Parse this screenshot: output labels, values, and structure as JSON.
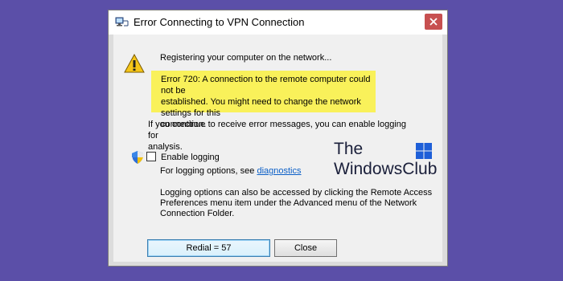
{
  "window": {
    "title": "Error Connecting to VPN Connection"
  },
  "content": {
    "registering": "Registering your computer on the network...",
    "error_line1": "Error 720: A connection to the remote computer could not be",
    "error_line2": "established.  You might need to change the network settings for this",
    "error_line3": "connection.",
    "continue_line1": "If you continue to receive error messages, you can enable logging for",
    "continue_line2": "analysis.",
    "enable_logging_label": "Enable logging",
    "enable_logging_checked": false,
    "logging_options_prefix": "For logging options, see ",
    "diagnostics_link": "diagnostics",
    "logging_line1": "Logging options can also be accessed by clicking the Remote Access",
    "logging_line2": "Preferences menu item under the Advanced menu of the Network",
    "logging_line3": "Connection Folder."
  },
  "buttons": {
    "redial": "Redial = 57",
    "close": "Close"
  },
  "watermark": {
    "line1": "The",
    "line2": "WindowsClub"
  },
  "colors": {
    "background": "#5b4fa8",
    "error_highlight": "#f9f15a",
    "close_button_red": "#c75050",
    "link": "#0b5fc7"
  }
}
